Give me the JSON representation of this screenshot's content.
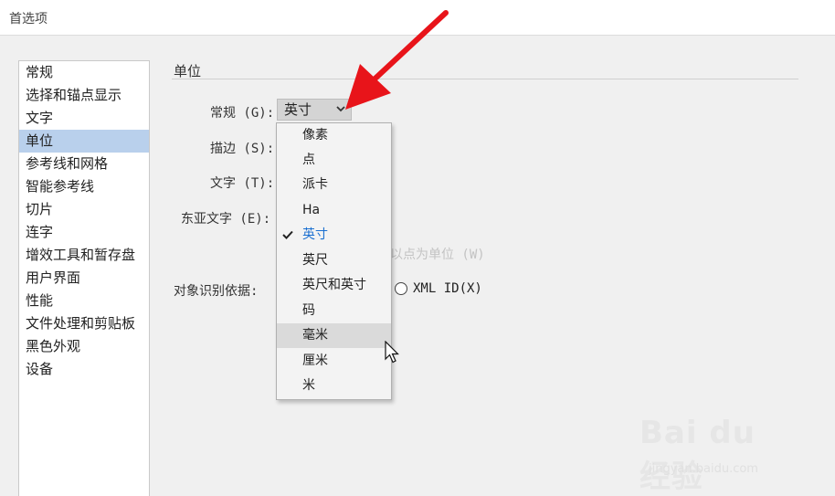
{
  "window": {
    "title": "首选项"
  },
  "sidebar": {
    "items": [
      {
        "label": "常规"
      },
      {
        "label": "选择和锚点显示"
      },
      {
        "label": "文字"
      },
      {
        "label": "单位",
        "selected": true
      },
      {
        "label": "参考线和网格"
      },
      {
        "label": "智能参考线"
      },
      {
        "label": "切片"
      },
      {
        "label": "连字"
      },
      {
        "label": "增效工具和暂存盘"
      },
      {
        "label": "用户界面"
      },
      {
        "label": "性能"
      },
      {
        "label": "文件处理和剪贴板"
      },
      {
        "label": "黑色外观"
      },
      {
        "label": "设备"
      }
    ]
  },
  "units": {
    "section_title": "单位",
    "general_label": "常规 (G):",
    "general_value": "英寸",
    "stroke_label": "描边 (S):",
    "type_label": "文字 (T):",
    "asian_type_label": "东亚文字 (E):",
    "hint_text": "以点为单位 (W)",
    "object_id_label": "对象识别依据:",
    "xml_id_option": "XML ID(X)"
  },
  "dropdown": {
    "options": [
      {
        "label": "像素"
      },
      {
        "label": "点"
      },
      {
        "label": "派卡"
      },
      {
        "label": "Ha"
      },
      {
        "label": "英寸",
        "checked": true
      },
      {
        "label": "英尺"
      },
      {
        "label": "英尺和英寸"
      },
      {
        "label": "码"
      },
      {
        "label": "毫米",
        "hovered": true
      },
      {
        "label": "厘米"
      },
      {
        "label": "米"
      }
    ]
  },
  "watermark": {
    "line1": "Bai du 经验",
    "line2": "jingyan.baidu.com"
  },
  "colors": {
    "selection": "#b9d0ec",
    "checked_text": "#1a6fd0",
    "annotation_arrow": "#e8141a",
    "hover": "#dadada"
  }
}
